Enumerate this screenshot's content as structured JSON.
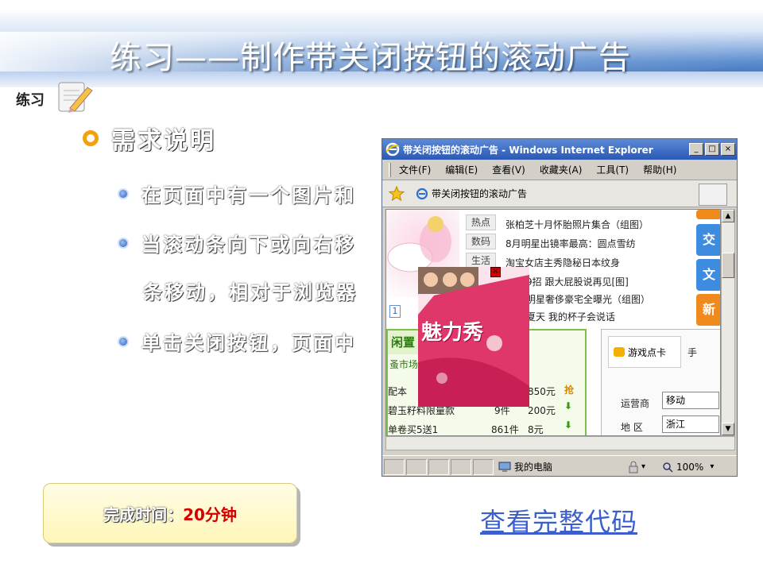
{
  "slide": {
    "title": "练习——制作带关闭按钮的滚动广告",
    "badge": "练习",
    "heading": "需求说明",
    "bullets": [
      "在页面中有一个图片和",
      "当滚动条向下或向右移",
      "单击关闭按钮，页面中"
    ],
    "bullet2_cont": "条移动，相对于浏览器",
    "time_label": "完成时间：",
    "time_value": "20分钟",
    "code_link": "查看完整代码"
  },
  "browser": {
    "window_title": "带关闭按钮的滚动广告 - Windows Internet Explorer",
    "window_buttons": [
      "_",
      "□",
      "×"
    ],
    "menu": [
      "文件(F)",
      "编辑(E)",
      "查看(V)",
      "收藏夹(A)",
      "工具(T)",
      "帮助(H)"
    ],
    "tab_title": "带关闭按钮的滚动广告",
    "status_zone": "我的电脑",
    "zoom": "100%"
  },
  "webpage": {
    "tags": [
      "热点",
      "数码",
      "生活"
    ],
    "news": [
      "张柏芝十月怀胎照片集合（组图）",
      "8月明星出镜率最高：圆点雪纺",
      "淘宝女店主秀隐秘日本纹身",
      "9招 跟大屁股说再见[图]",
      "明星奢侈豪宅全曝光（组图）",
      "夏天 我的杯子会说话"
    ],
    "side_buttons": [
      "交",
      "文",
      "新"
    ],
    "panel_head": "闲置",
    "panel_sub": "蚤市场",
    "rows": [
      {
        "name": "配本",
        "count": "",
        "price": "850元"
      },
      {
        "name": "碧玉籽料限量款",
        "count": "9件",
        "price": "200元"
      },
      {
        "name": "单卷买5送1",
        "count": "861件",
        "price": "8元"
      }
    ],
    "game_tab": "游戏点卡",
    "phone_tab": "手",
    "carrier_label": "运营商",
    "carrier_value": "移动",
    "region_label": "地 区",
    "region_value": "浙江",
    "pager": "1",
    "ad_text": "魅力秀"
  },
  "colors": {
    "accent_orange": "#f2a10d",
    "link_blue": "#3a5fcd",
    "time_red": "#d40000"
  }
}
